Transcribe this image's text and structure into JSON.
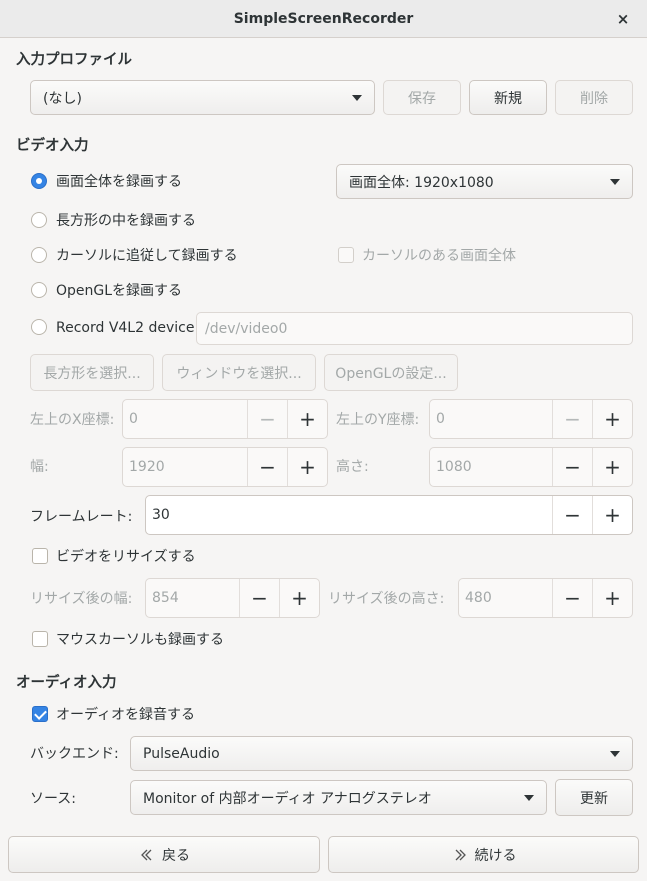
{
  "window": {
    "title": "SimpleScreenRecorder",
    "close_label": "×"
  },
  "input_profile": {
    "heading": "入力プロファイル",
    "selected": "(なし)",
    "save_label": "保存",
    "new_label": "新規",
    "delete_label": "削除"
  },
  "video_input": {
    "heading": "ビデオ入力",
    "options": {
      "fullscreen": "画面全体を録画する",
      "rectangle": "長方形の中を録画する",
      "follow_cursor": "カーソルに追従して録画する",
      "opengl": "OpenGLを録画する",
      "v4l2": "Record V4L2 device"
    },
    "selected_option": "fullscreen",
    "screen_select": "画面全体: 1920x1080",
    "cursor_screen_label": "カーソルのある画面全体",
    "v4l2_device": "/dev/video0",
    "select_rect_label": "長方形を選択...",
    "select_window_label": "ウィンドウを選択...",
    "opengl_settings_label": "OpenGLの設定...",
    "left_x_label": "左上のX座標:",
    "left_x_value": "0",
    "top_y_label": "左上のY座標:",
    "top_y_value": "0",
    "width_label": "幅:",
    "width_value": "1920",
    "height_label": "高さ:",
    "height_value": "1080",
    "framerate_label": "フレームレート:",
    "framerate_value": "30",
    "resize_label": "ビデオをリサイズする",
    "resize_width_label": "リサイズ後の幅:",
    "resize_width_value": "854",
    "resize_height_label": "リサイズ後の高さ:",
    "resize_height_value": "480",
    "record_cursor_label": "マウスカーソルも録画する"
  },
  "audio_input": {
    "heading": "オーディオ入力",
    "record_audio_label": "オーディオを録音する",
    "record_audio_checked": true,
    "backend_label": "バックエンド:",
    "backend_value": "PulseAudio",
    "source_label": "ソース:",
    "source_value": "Monitor of 内部オーディオ アナログステレオ",
    "refresh_label": "更新"
  },
  "footer": {
    "back_label": "戻る",
    "continue_label": "続ける"
  },
  "spin_symbols": {
    "minus": "−",
    "plus": "+"
  },
  "colors": {
    "accent": "#3584e4",
    "background": "#f6f5f4"
  }
}
